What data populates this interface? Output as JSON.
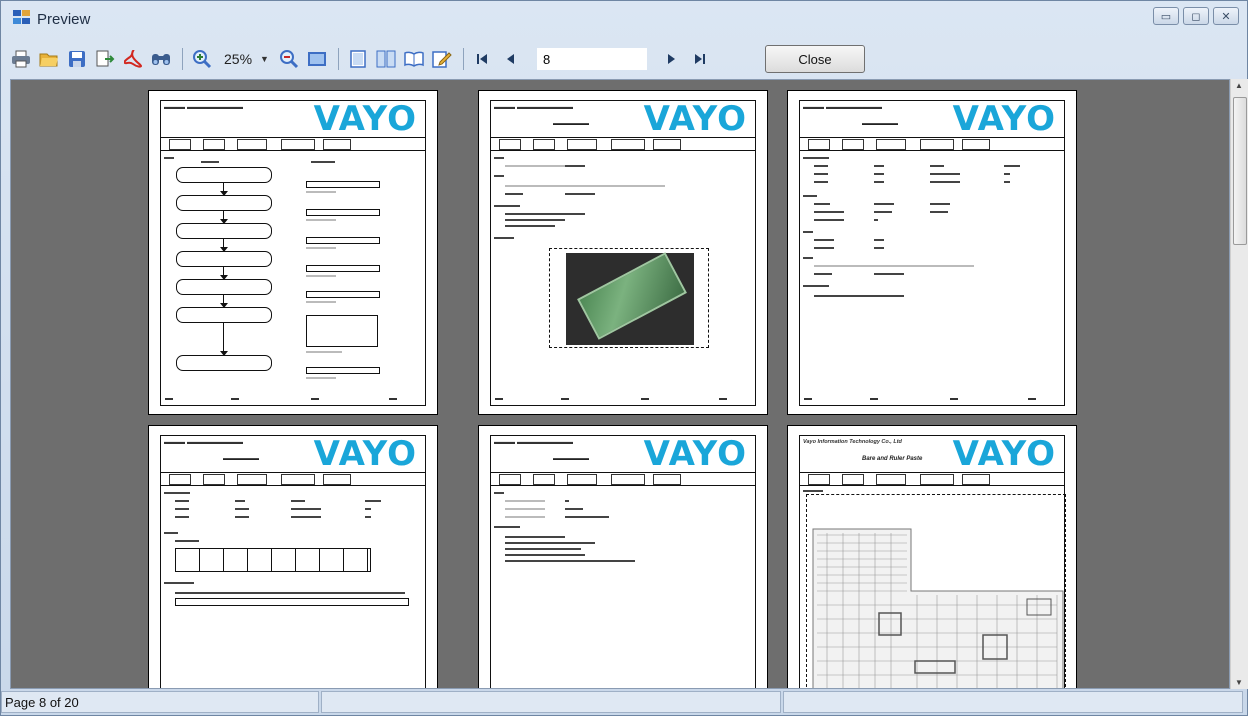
{
  "window": {
    "title": "Preview",
    "controls": [
      "minimize",
      "maximize",
      "close"
    ]
  },
  "toolbar": {
    "icons": [
      "print-icon",
      "open-icon",
      "save-icon",
      "export-icon",
      "pdf-icon",
      "find-icon",
      "zoom-in-icon",
      "zoom-out-icon",
      "full-page-icon",
      "single-page-icon",
      "multi-page-icon",
      "book-view-icon",
      "edit-icon",
      "first-page-icon",
      "prev-page-icon",
      "next-page-icon",
      "last-page-icon"
    ],
    "zoom_value": "25%",
    "page_number": "8",
    "close_label": "Close"
  },
  "document": {
    "logo_text": "VAYO",
    "company_line": "Vayo Information Technology Co., Ltd",
    "special_subtitle": "Bare and Ruler Paste",
    "pages_visible": 6
  },
  "statusbar": {
    "page_info": "Page 8 of 20"
  },
  "colors": {
    "logo": "#1aa6d9",
    "viewport_bg": "#6e6e6e",
    "window_bg": "#dbe6f3"
  }
}
